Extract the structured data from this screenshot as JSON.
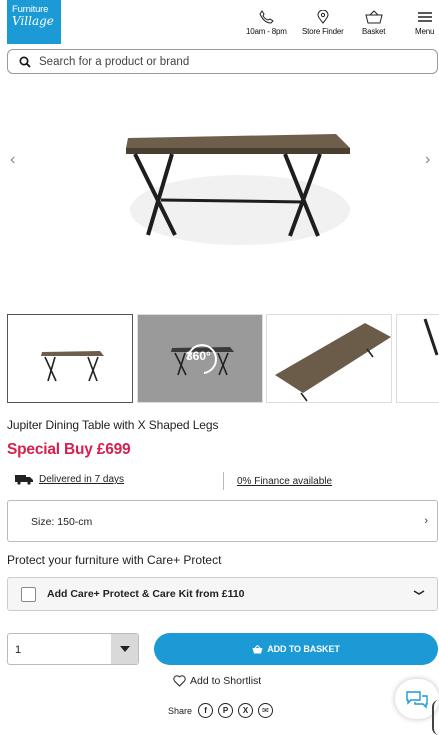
{
  "header": {
    "logo_line1": "Furniture",
    "logo_line2": "Village",
    "nav": [
      {
        "label": "10am - 8pm",
        "icon": "phone-icon"
      },
      {
        "label": "Store Finder",
        "icon": "map-pin-icon"
      },
      {
        "label": "Basket",
        "icon": "basket-icon"
      },
      {
        "label": "Menu",
        "icon": "hamburger-menu-icon"
      }
    ]
  },
  "search": {
    "placeholder": "Search for a product or brand"
  },
  "product": {
    "title": "Jupiter Dining Table with X Shaped Legs",
    "price": "Special Buy £699",
    "badge_360": "360°"
  },
  "delivery": {
    "text": "Delivered in 7 days",
    "finance": "0% Finance available"
  },
  "size": {
    "label": "Size: 150-cm"
  },
  "care": {
    "heading": "Protect your furniture with Care+ Protect",
    "option": "Add Care+ Protect & Care Kit from £110"
  },
  "purchase": {
    "quantity": "1",
    "add_to_basket": "ADD TO BASKET",
    "shortlist": "Add to Shortlist",
    "share": "Share"
  },
  "colors": {
    "brand_blue": "#1b9ad6",
    "price_red": "#d6204e"
  }
}
